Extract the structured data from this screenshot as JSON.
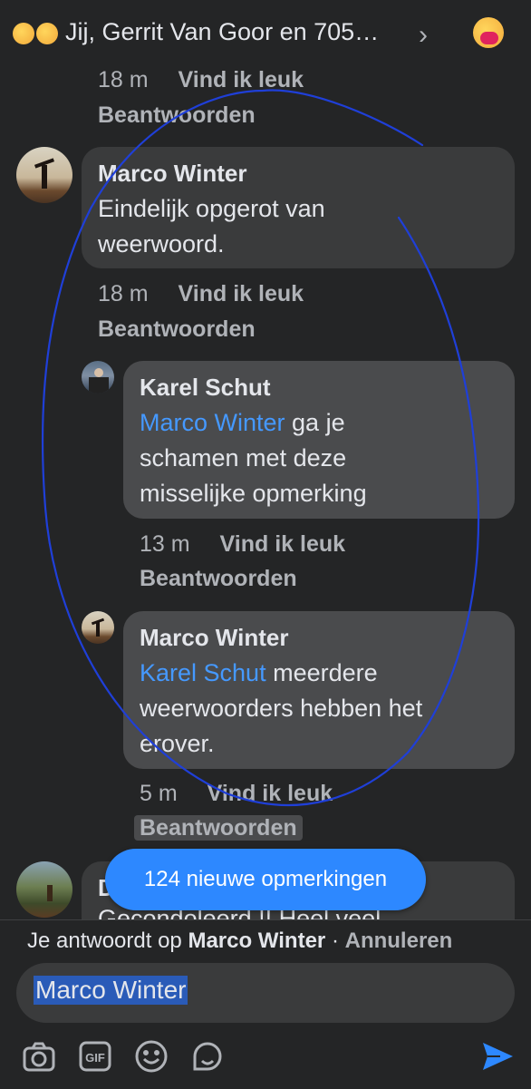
{
  "header": {
    "title": "Jij, Gerrit Van Goor en 705…",
    "chevron_icon": "chevron-right-icon",
    "reaction_icon": "care-reaction-icon"
  },
  "comments": [
    {
      "time": "18 m",
      "like_label": "Vind ik leuk",
      "reply_label": "Beantwoorden"
    },
    {
      "author": "Marco Winter",
      "text": "Eindelijk opgerot van weerwoord.",
      "time": "18 m",
      "like_label": "Vind ik leuk",
      "reply_label": "Beantwoorden"
    },
    {
      "author": "Karel Schut",
      "mention": "Marco Winter",
      "text": " ga je schamen met deze misselijke opmerking",
      "time": "13 m",
      "like_label": "Vind ik leuk",
      "reply_label": "Beantwoorden"
    },
    {
      "author": "Marco Winter",
      "mention": "Karel Schut",
      "text": " meerdere weerwoorders hebben het erover.",
      "time": "5 m",
      "like_label": "Vind ik leuk",
      "reply_label": "Beantwoorden"
    },
    {
      "author": "D",
      "text": "Gecondoleerd !! Heel veel"
    }
  ],
  "toast": {
    "label": "124 nieuwe opmerkingen"
  },
  "composer": {
    "replying_prefix": "Je antwoordt op",
    "replying_to": "Marco Winter",
    "separator": "·",
    "cancel_label": "Annuleren",
    "input_value": "Marco Winter",
    "tools": [
      "camera-icon",
      "gif-icon",
      "emoji-icon",
      "sticker-icon"
    ],
    "send_icon": "send-icon"
  },
  "colors": {
    "background": "#242526",
    "bubble": "#3a3b3c",
    "mention": "#4599ff",
    "toast": "#2d88ff",
    "annotation": "#1f3fd8"
  }
}
